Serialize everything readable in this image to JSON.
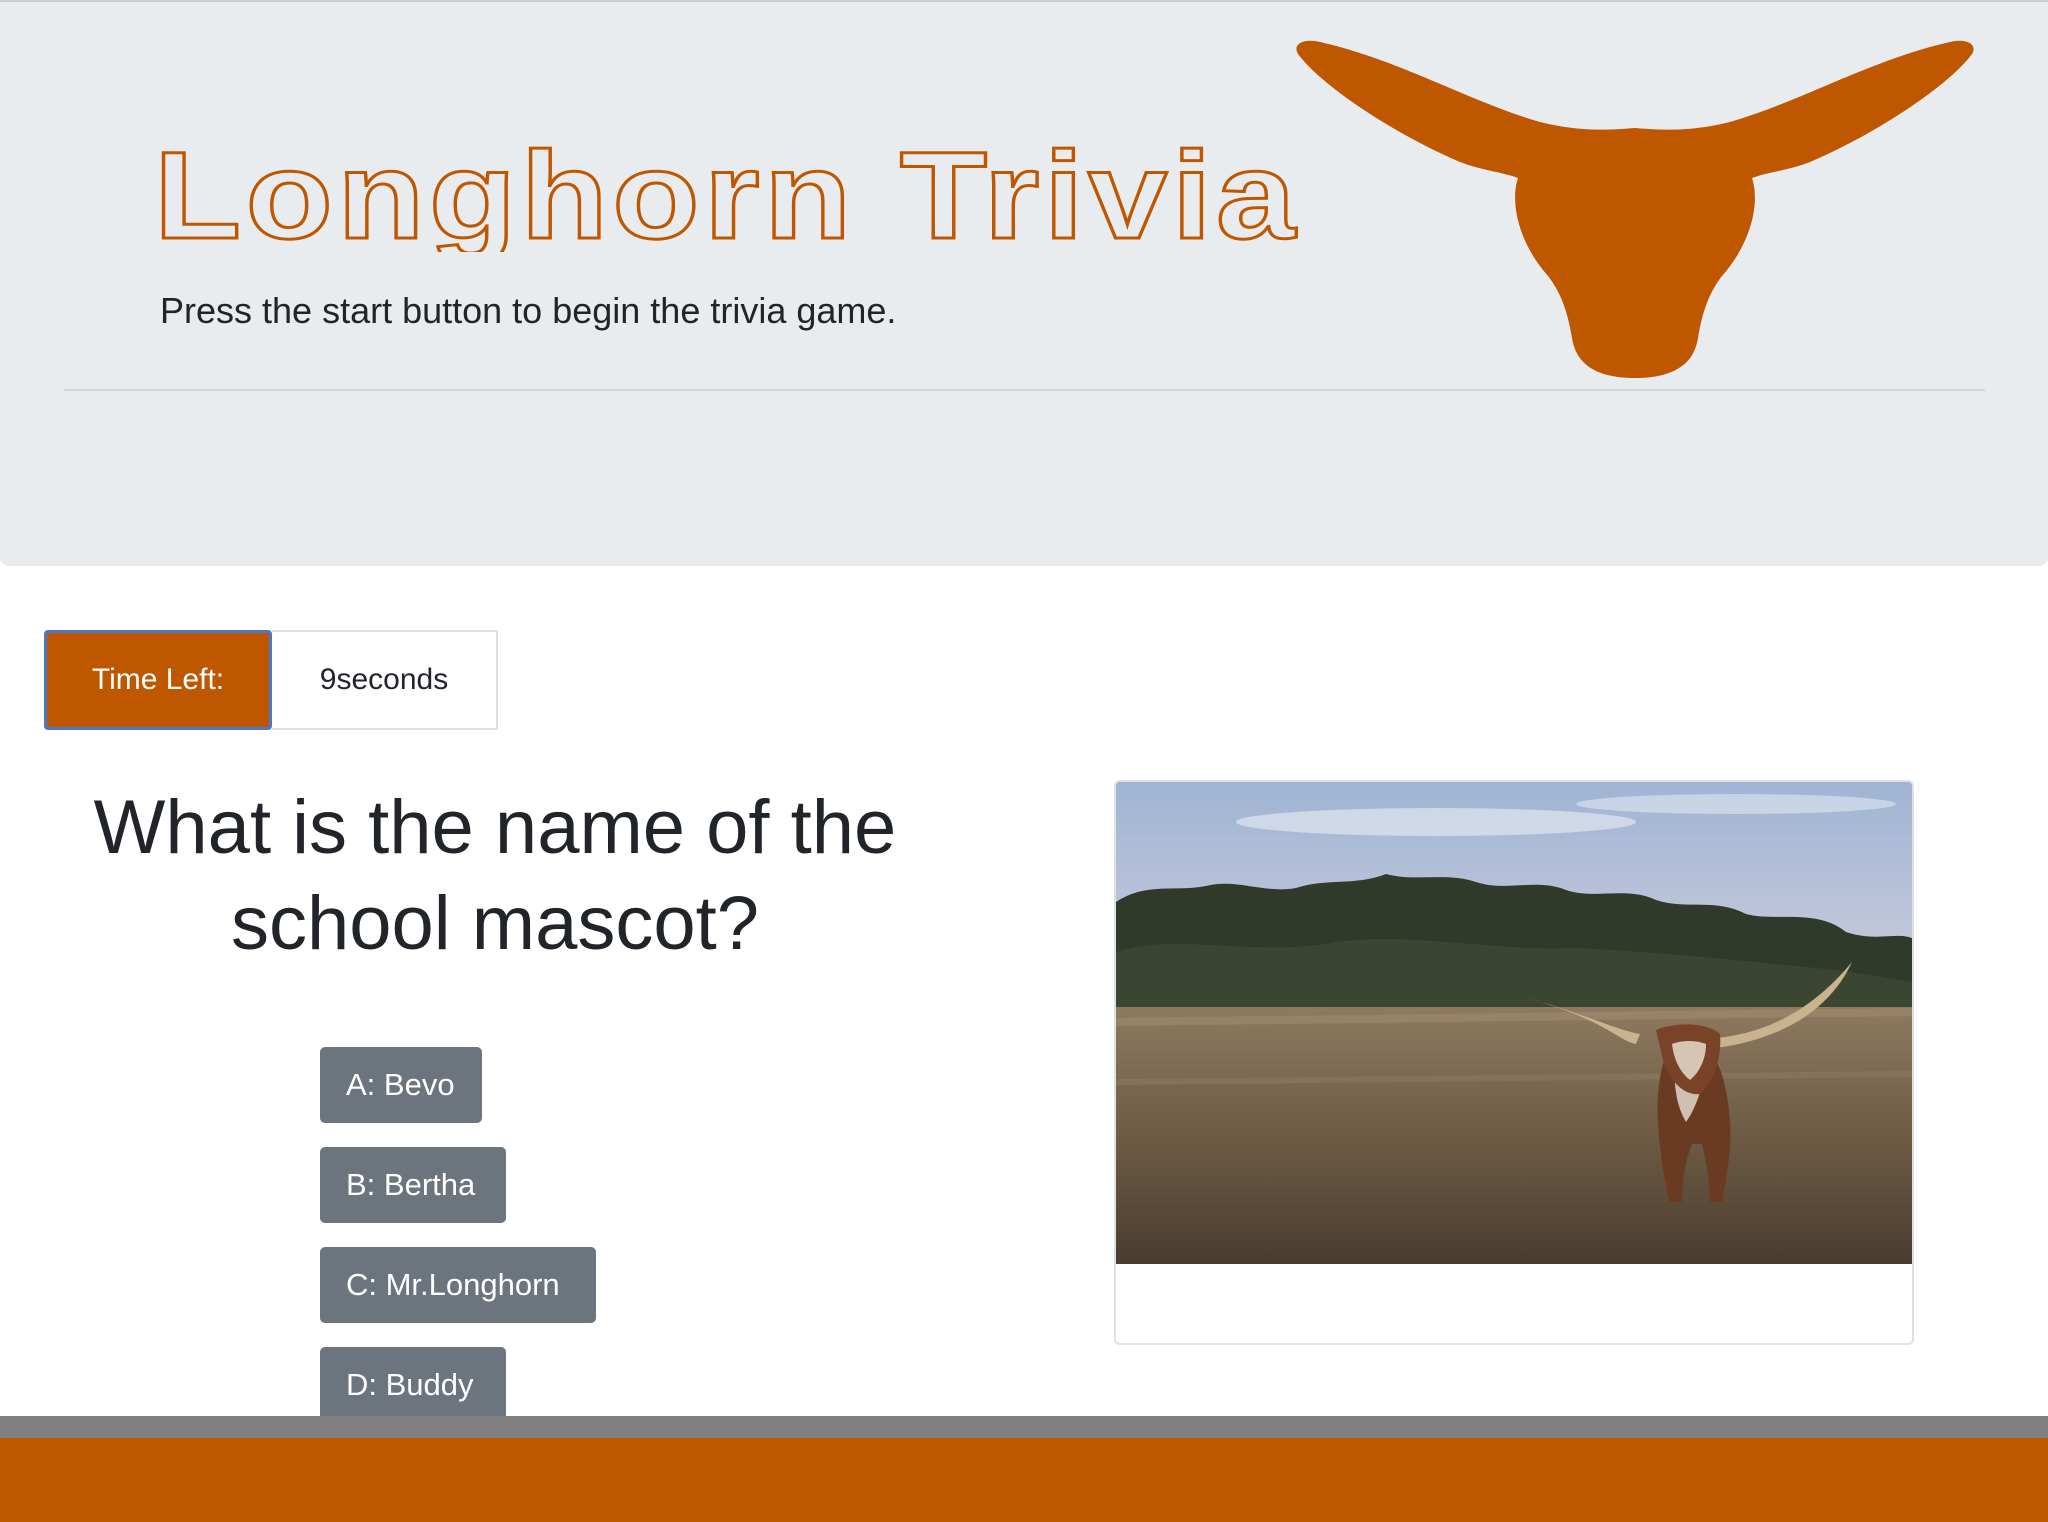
{
  "colors": {
    "burnt_orange": "#bf5700",
    "jumbotron_bg": "#e9ecef",
    "button_gray": "#6c757d",
    "footer_gray": "#808080"
  },
  "header": {
    "title": "Longhorn Trivia",
    "subtitle": "Press the start button to begin the trivia game.",
    "logo_icon": "longhorn-head-icon"
  },
  "timer": {
    "label": "Time Left:",
    "value": "9seconds"
  },
  "question": {
    "text": "What is the name of the school mascot?"
  },
  "answers": [
    {
      "label": "A: Bevo"
    },
    {
      "label": "B: Bertha"
    },
    {
      "label": "C: Mr.Longhorn"
    },
    {
      "label": "D: Buddy"
    }
  ],
  "photo": {
    "subject": "longhorn-steer-in-field-photo"
  }
}
